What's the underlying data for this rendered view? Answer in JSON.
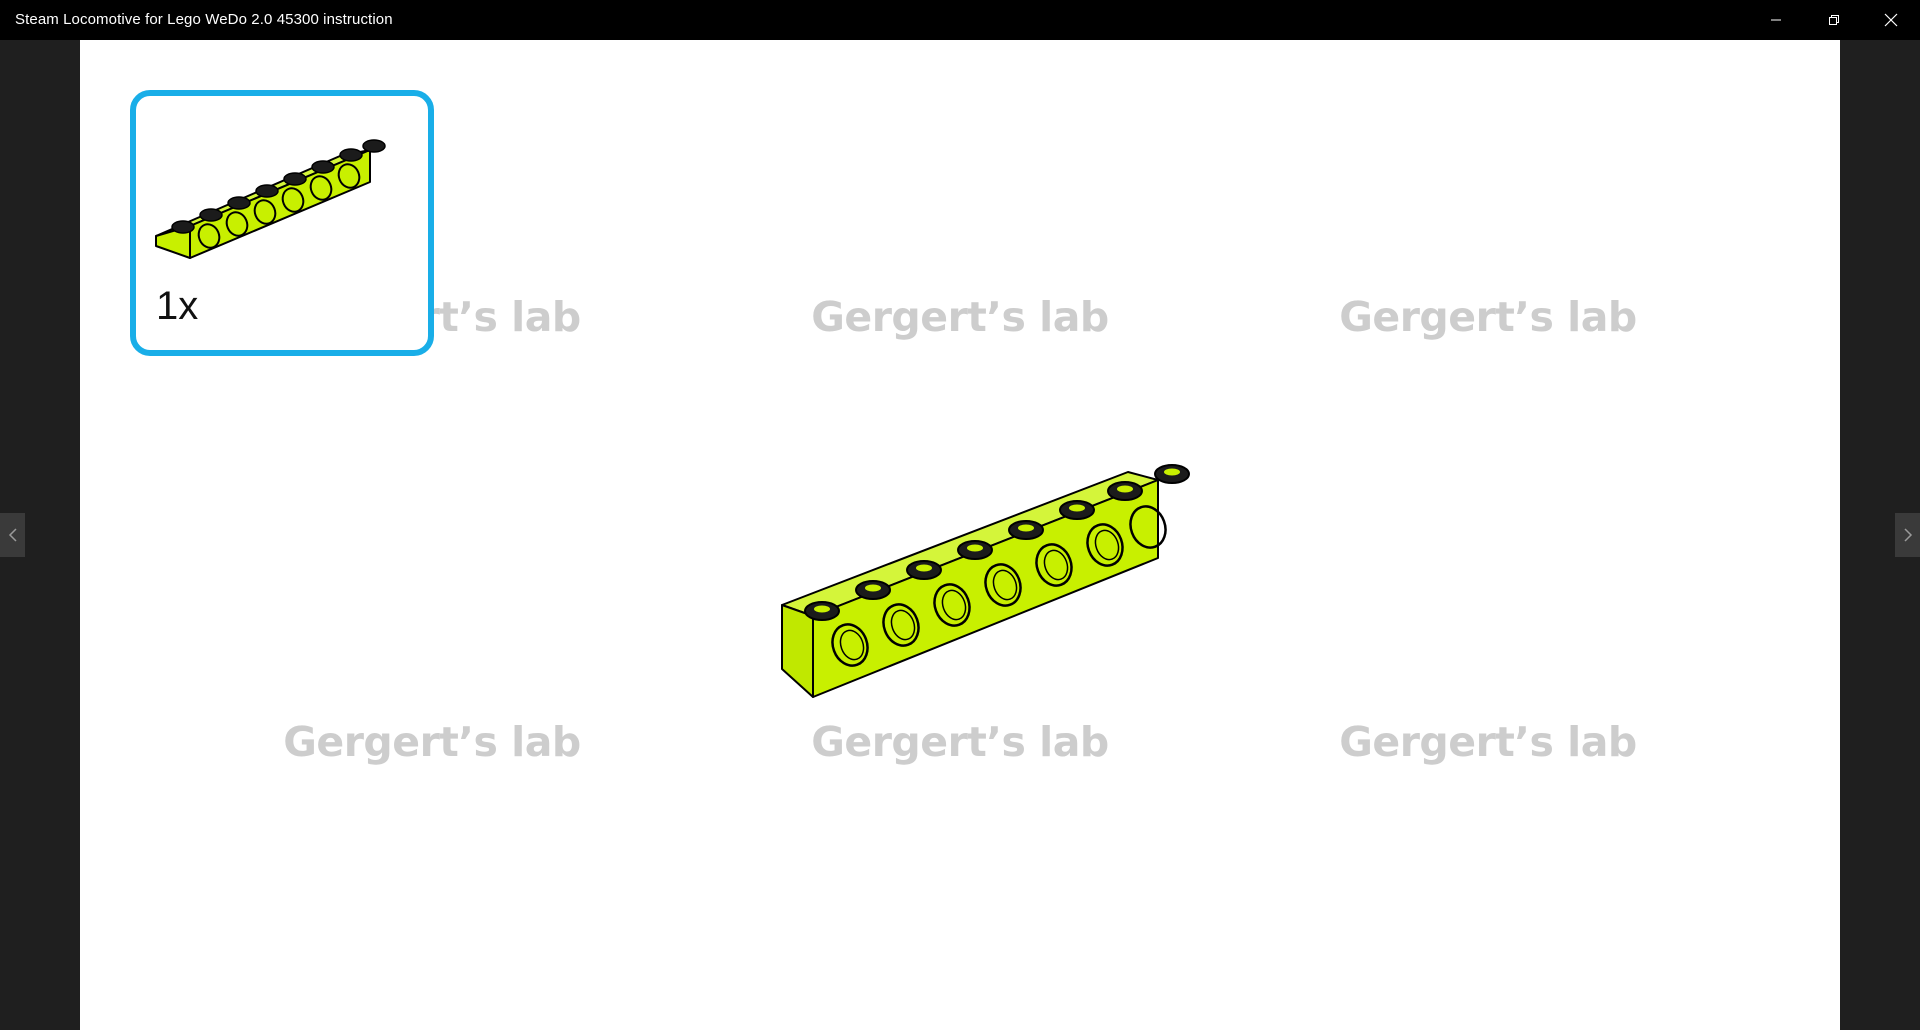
{
  "window": {
    "title": "Steam Locomotive for Lego WeDo 2.0 45300 instruction",
    "controls": [
      "minimize-icon",
      "restore-icon",
      "close-icon"
    ]
  },
  "step": {
    "parts_needed": [
      {
        "part": "technic-brick-1x8-with-holes",
        "color": "#c8f000",
        "quantity_label": "1x"
      }
    ],
    "model_part": "technic-brick-1x8-with-holes",
    "model_part_color": "#c8f000",
    "callout_border_color": "#19aee8"
  },
  "watermarks": [
    "Gergert’s lab",
    "Gergert’s lab",
    "Gergert’s lab",
    "Gergert’s lab",
    "Gergert’s lab",
    "Gergert’s lab"
  ],
  "navigation": {
    "prev_icon": "chevron-left-icon",
    "next_icon": "chevron-right-icon"
  }
}
